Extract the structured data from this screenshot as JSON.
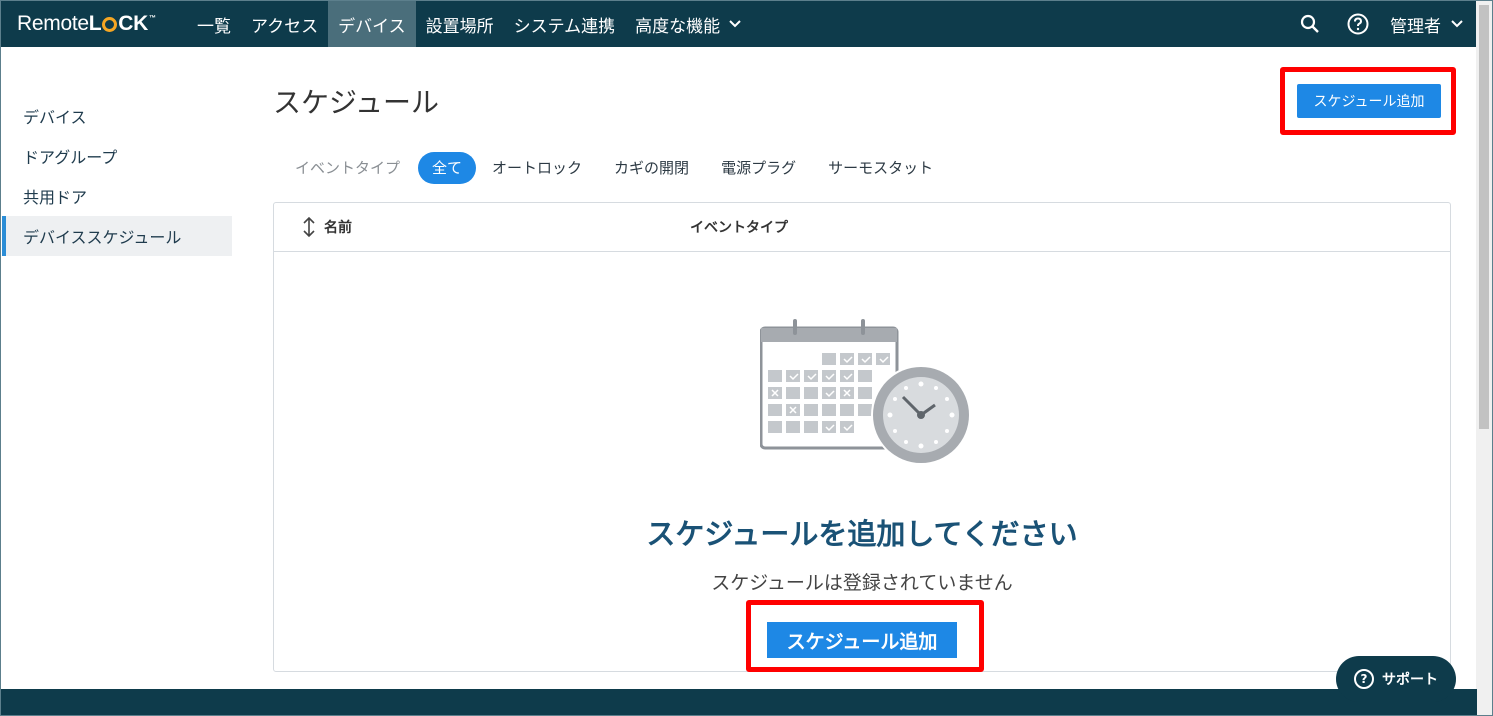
{
  "brand": {
    "logo_text_1": "Remote",
    "logo_text_2": "L",
    "logo_text_3": "CK",
    "logo_tm": "™"
  },
  "nav": {
    "items": [
      {
        "label": "一覧"
      },
      {
        "label": "アクセス"
      },
      {
        "label": "デバイス",
        "active": true
      },
      {
        "label": "設置場所"
      },
      {
        "label": "システム連携"
      },
      {
        "label": "高度な機能"
      }
    ],
    "admin_label": "管理者",
    "icons": [
      "search-icon",
      "help-icon",
      "chevron-down-icon"
    ]
  },
  "sidebar": {
    "items": [
      {
        "label": "デバイス"
      },
      {
        "label": "ドアグループ"
      },
      {
        "label": "共用ドア"
      },
      {
        "label": "デバイススケジュール",
        "active": true
      }
    ]
  },
  "main": {
    "title": "スケジュール",
    "add_button_label": "スケジュール追加",
    "filter": {
      "label": "イベントタイプ",
      "tabs": [
        {
          "label": "全て",
          "active": true
        },
        {
          "label": "オートロック"
        },
        {
          "label": "カギの開閉"
        },
        {
          "label": "電源プラグ"
        },
        {
          "label": "サーモスタット"
        }
      ]
    },
    "table": {
      "columns": [
        "名前",
        "イベントタイプ"
      ]
    },
    "empty": {
      "title": "スケジュールを追加してください",
      "subtitle": "スケジュールは登録されていません",
      "button_label": "スケジュール追加"
    }
  },
  "support": {
    "label": "サポート"
  },
  "colors": {
    "nav_bg": "#0e3b4b",
    "accent": "#1e88e5",
    "highlight": "#ff0000",
    "title_blue": "#1a5276"
  }
}
